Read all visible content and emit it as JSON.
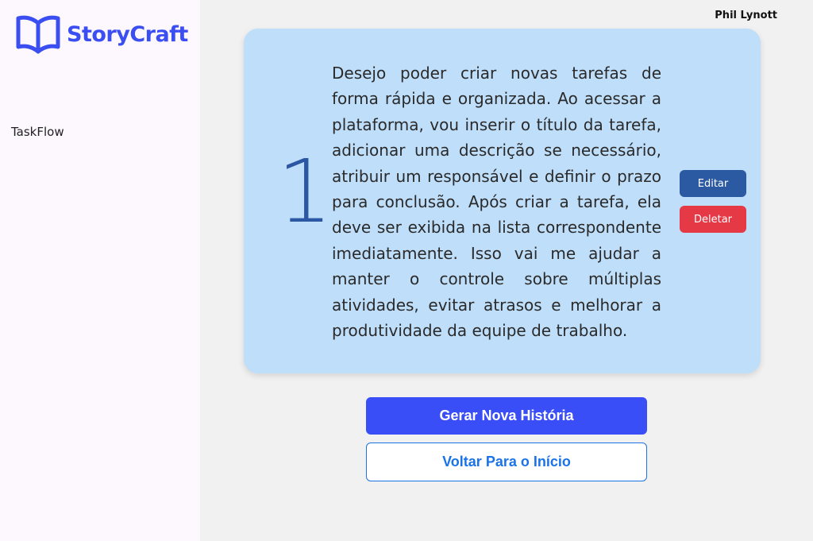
{
  "app": {
    "name": "StoryCraft",
    "brand_color": "#3a4ef2",
    "logo_icon": "open-book-icon"
  },
  "sidebar": {
    "items": [
      {
        "label": "TaskFlow"
      }
    ]
  },
  "header": {
    "user_name": "Phil Lynott"
  },
  "story": {
    "number": "1",
    "text": "Desejo poder criar novas tarefas de forma rápida e organizada. Ao acessar a plataforma, vou inserir o título da tarefa, adicionar uma descrição se necessário, atribuir um responsável e definir o prazo para conclusão. Após criar a tarefa, ela deve ser exibida na lista correspondente imediatamente. Isso vai me ajudar a manter o controle sobre múltiplas atividades, evitar atrasos e melhorar a produtividade da equipe de trabalho.",
    "edit_label": "Editar",
    "delete_label": "Deletar",
    "card_color": "#bfdefa",
    "edit_color": "#2c5aa2",
    "delete_color": "#e63946"
  },
  "actions": {
    "generate_label": "Gerar Nova História",
    "back_label": "Voltar Para o Início",
    "generate_color": "#3a4ef8",
    "back_color": "#1a73e8"
  }
}
